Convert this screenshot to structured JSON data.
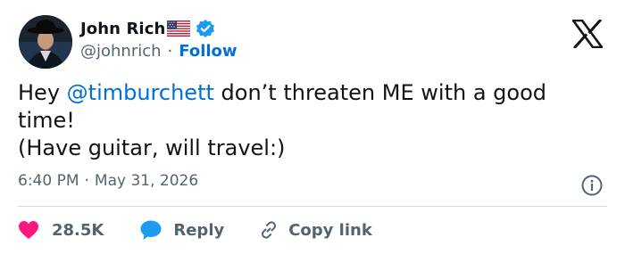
{
  "author": {
    "display_name": "John Rich",
    "handle": "@johnrich",
    "separator": "·",
    "follow_label": "Follow",
    "flag_icon": "us-flag-icon",
    "verified_icon": "verified-badge-icon"
  },
  "tweet": {
    "text_before_mention": "Hey ",
    "mention": "@timburchett",
    "text_after_mention": " don’t threaten ME with a good",
    "line2": "time!",
    "line3": "(Have guitar, will travel:)"
  },
  "meta": {
    "time": "6:40 PM",
    "separator": "·",
    "date": "May 31, 2026",
    "info_icon": "info-icon"
  },
  "actions": {
    "likes": "28.5K",
    "reply_label": "Reply",
    "copy_link_label": "Copy link"
  },
  "colors": {
    "link": "#006fd6",
    "like": "#f91880",
    "reply": "#1d9bf0",
    "secondary_text": "#536471",
    "primary_text": "#0f1419"
  }
}
